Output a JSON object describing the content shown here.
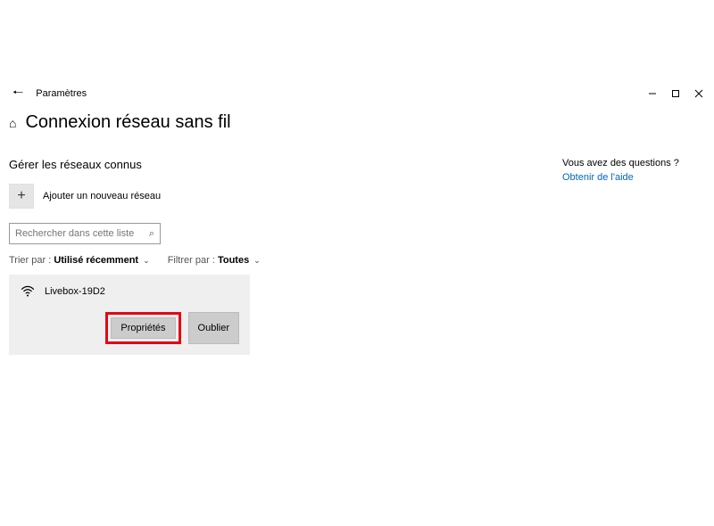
{
  "titlebar": {
    "title": "Paramètres"
  },
  "page": {
    "title": "Connexion réseau sans fil"
  },
  "section": {
    "header": "Gérer les réseaux connus"
  },
  "add": {
    "label": "Ajouter un nouveau réseau"
  },
  "search": {
    "placeholder": "Rechercher dans cette liste"
  },
  "sort": {
    "label": "Trier par :",
    "value": "Utilisé récemment"
  },
  "filter": {
    "label": "Filtrer par :",
    "value": "Toutes"
  },
  "network": {
    "name": "Livebox-19D2",
    "properties": "Propriétés",
    "forget": "Oublier"
  },
  "help": {
    "question": "Vous avez des questions ?",
    "link": "Obtenir de l'aide"
  }
}
